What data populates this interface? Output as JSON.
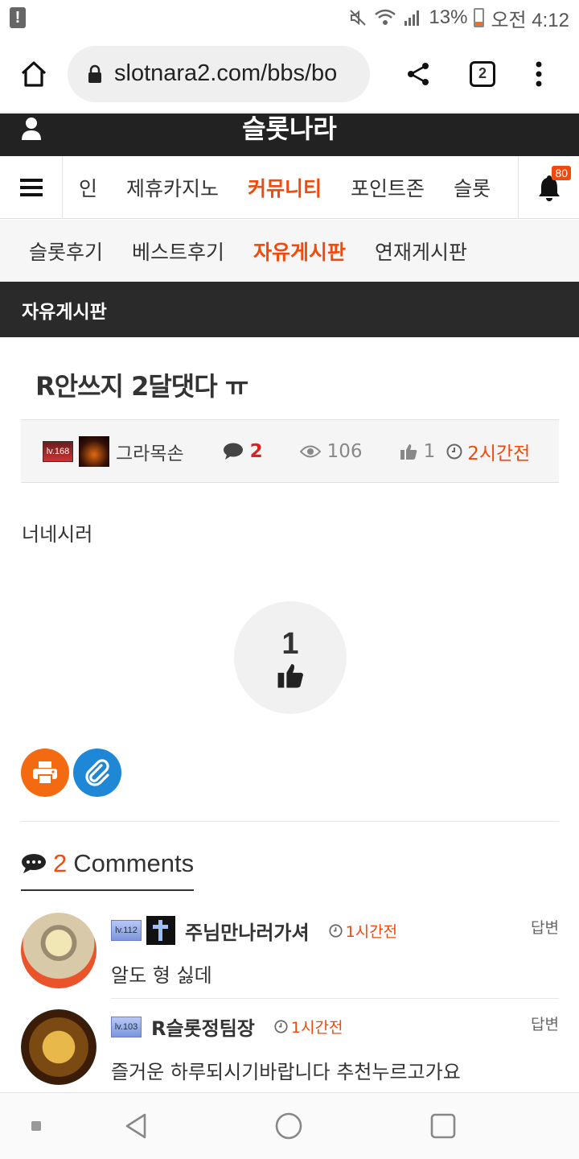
{
  "status_bar": {
    "battery": "13%",
    "time": "오전 4:12"
  },
  "browser": {
    "url": "slotnara2.com/bbs/bo",
    "tab_count": "2"
  },
  "site": {
    "title": "슬롯나라"
  },
  "main_nav": {
    "items": [
      "인",
      "제휴카지노",
      "커뮤니티",
      "포인트존",
      "슬롯"
    ],
    "active_index": 2,
    "notification_count": "80"
  },
  "sub_nav": {
    "items": [
      "슬롯후기",
      "베스트후기",
      "자유게시판",
      "연재게시판"
    ],
    "active_index": 2
  },
  "board": {
    "title": "자유게시판"
  },
  "post": {
    "title": "R안쓰지 2달댓다 ㅠ",
    "author_level": "lv.168",
    "author": "그라목손",
    "comment_count": "2",
    "views": "106",
    "likes": "1",
    "time": "2시간전",
    "body": "너네시러",
    "like_button_count": "1"
  },
  "comments_section": {
    "count": "2",
    "label": "Comments"
  },
  "comments": [
    {
      "level": "lv.112",
      "author": "주님만나러가셔",
      "time": "1시간전",
      "text": "알도 형 싫데",
      "reply_label": "답변"
    },
    {
      "level": "lv.103",
      "author": "R슬롯정팀장",
      "time": "1시간전",
      "text": "즐거운 하루되시기바랍니다 추천누르고가요",
      "reply_label": "답변"
    }
  ],
  "colors": {
    "accent": "#f04a0c",
    "header_bg": "#222222",
    "print_button": "#f36a10",
    "link_button": "#1f88d6"
  }
}
